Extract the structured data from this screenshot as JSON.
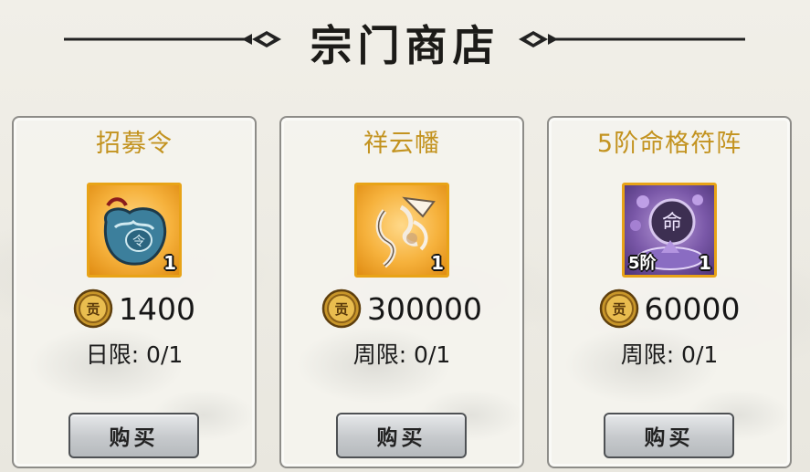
{
  "header": {
    "title": "宗门商店"
  },
  "items": [
    {
      "name": "招募令",
      "icon": "recruit-token-icon",
      "quantity": "1",
      "tier": "",
      "price": "1400",
      "limit": "日限: 0/1",
      "buy_label": "购买"
    },
    {
      "name": "祥云幡",
      "icon": "auspicious-cloud-banner-icon",
      "quantity": "1",
      "tier": "",
      "price": "300000",
      "limit": "周限: 0/1",
      "buy_label": "购买"
    },
    {
      "name": "5阶命格符阵",
      "icon": "fate-talisman-array-icon",
      "quantity": "1",
      "tier": "5阶",
      "price": "60000",
      "limit": "周限: 0/1",
      "buy_label": "购买"
    }
  ],
  "currency": {
    "icon": "contribution-coin-icon",
    "glyph": "贡"
  },
  "colors": {
    "title_gold": "#c39320",
    "frame_orange": "#e8a317",
    "background": "#eeece4"
  }
}
